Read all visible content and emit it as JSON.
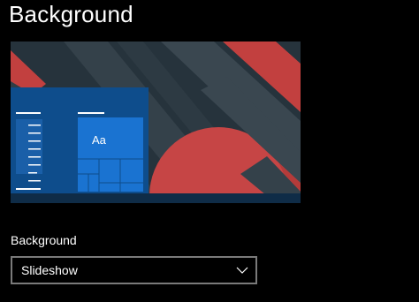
{
  "page": {
    "title": "Background"
  },
  "preview": {
    "sample_text": "Aa",
    "colors": {
      "wallpaper_dark": "#26333c",
      "stripe_gray": "#3a4750",
      "stripe_red": "#c2403f",
      "circle_red": "#c64545",
      "window_blue": "#0e4d8c",
      "tile_blue": "#1a73d1",
      "taskbar": "#0f2c47"
    },
    "icons": [
      "start-menu-preview",
      "aa-tile"
    ]
  },
  "background_setting": {
    "label": "Background",
    "selected": "Slideshow",
    "chevron_icon": "chevron-down-icon"
  }
}
